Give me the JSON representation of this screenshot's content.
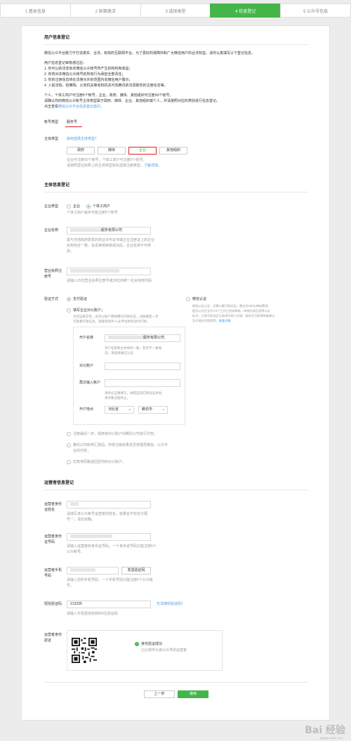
{
  "steps": [
    "1 基本信息",
    "2 邮箱激活",
    "3 选择类型",
    "4 信息登记",
    "5 公众号信息"
  ],
  "active_step": 3,
  "section_user": {
    "title": "用户信息登记",
    "intro": "微信公众平台致力于打造真实、合法、有效的互联网平台。为了更好的保障你和广大微信用户的合法权益，请你认真填写以下登记信息。",
    "review_title": "用户信息登记审核通过后：",
    "review_items": [
      "1. 你可以依法享有本微信公众帐号所产生的权利和收益；",
      "2. 你将对本微信公众帐号的所有行为承担全部责任；",
      "3. 你的注册信息将在法律允许的范围内向微信用户展示；",
      "4. 人民法院、检察院、公安机关等有权机关可向腾讯依法调取你的注册信息等。"
    ],
    "limit_1": "个人、个体工商户可注册5个帐号，企业、政府、媒体、其他组织可注册50个帐号。",
    "limit_2": "请确认你的微信公众帐号主体类型属于政府、媒体、企业、其他组织或个人，并请按照对应的类别进行信息登记。",
    "link_prefix": "点击查看",
    "link_text": "微信公众平台信息登记指引。"
  },
  "account_type": {
    "label": "帐号类型",
    "value": "服务号"
  },
  "subject_type": {
    "label": "主体类型",
    "help_link": "如何选择主体类型？",
    "options": [
      "政府",
      "媒体",
      "企业",
      "其他组织"
    ],
    "selected": "企业",
    "note_1": "企业可注册50个帐号，个体工商户可注册5个帐号。",
    "note_2_prefix": "请按照营业执照上的主体类型如实选择注册类型，",
    "note_2_link": "了解详情。"
  },
  "section_subject": {
    "title": "主体信息登记"
  },
  "company_type": {
    "label": "企业类型",
    "options": [
      "企业",
      "个体工商户"
    ],
    "selected": "个体工商户",
    "note": "个体工商户最多可能注册5个帐号"
  },
  "company_name": {
    "label": "企业名称",
    "value_suffix": "服务有限公司",
    "note_1": "需与当地政府颁发的商业许可证书或企业注册证上的企业",
    "note_2": "名称完全一致，信息审核审核成功后，企业名称不可修",
    "note_3": "改。"
  },
  "license": {
    "label_1": "营业执照注",
    "label_2": "册号",
    "note": "请输入15位营业执照注册号或18位的统一社会信用代码"
  },
  "verify": {
    "label": "验证方式",
    "option_pay": "支付验证",
    "option_wx": "微信认证",
    "wx_desc_1": "微信认证认证，无需小额打款验证，需支付300元审核费用。",
    "wx_desc_2": "提交认证后全仔1-5个工作日完成审核。审核完成后获得认证",
    "wx_desc_3": "标识，订阅号获自定义菜单可接入升级；服务号可获得高级接口",
    "wx_desc_4": "及开通支付权限等。",
    "wx_link": "查看详情",
    "pay_step1_1": "填写企业对公账户；",
    "pay_step1_2": "为验证真实性，此对公账户需给腾讯打款验证，注册最后一步",
    "pay_step1_3": "可查看打款信息，请联系财务人员/单位财务进行打款。",
    "payee_label": "开户名称",
    "payee_value": "服务有限公司",
    "payee_note_1": "开户名称和主体保持一致，若有不一致情",
    "payee_note_2": "况，请选择微信认证",
    "account_label": "对公账户",
    "account2_label": "再次输入账户",
    "account2_note_1": "请务必正确填写，填错造成打款验证失败，",
    "account2_note_2": "将导致流程终止。",
    "location_label": "开户地点",
    "province": "河北省",
    "city": "廊坊市",
    "pay_step2": "注册最后一步，需用该对公账户向腾讯公司进行打款；",
    "pay_step3_1": "腾讯公司收到汇款后，你将注册结果发至管理员微信。公众平",
    "pay_step3_2": "台的内容；",
    "pay_step4": "打款将原路退回至你的对公账户。"
  },
  "section_operator": {
    "title": "运营者信息登记"
  },
  "operator_name": {
    "label_1": "运营者身份",
    "label_2": "证姓名",
    "note_1": "请填写该公众帐号运营者的姓名，如果名字包含分隔",
    "note_2": "号“·”，请勿省略。"
  },
  "operator_id": {
    "label_1": "运营者身份",
    "label_2": "证号码",
    "note_1": "请输入运营者的身份证号码，一个身份证号码只能注册5个",
    "note_2": "公众帐号。"
  },
  "operator_phone": {
    "label_1": "运营者手机",
    "label_2": "号码",
    "send_button": "发送验证码",
    "note_1": "请输入您的手机号码，一个手机号码只能注册5个公众帐",
    "note_2": "号。"
  },
  "sms_code": {
    "label": "短信验证码",
    "value": "213339",
    "link": "无法接收验证码？",
    "note": "请输入手机短信收到的6位验证码"
  },
  "operator_verify": {
    "label_1": "运营者身份",
    "label_2": "验证",
    "success": "身份验证成功",
    "sub": "将作为该公众号的运营者"
  },
  "footer": {
    "prev": "上一步",
    "next": "继续"
  },
  "watermark": {
    "text": "Bai 经验",
    "sub": "jingyan.baidu.com"
  },
  "colors": {
    "accent": "#44b549",
    "link": "#459ae9",
    "highlight": "#e02020"
  }
}
